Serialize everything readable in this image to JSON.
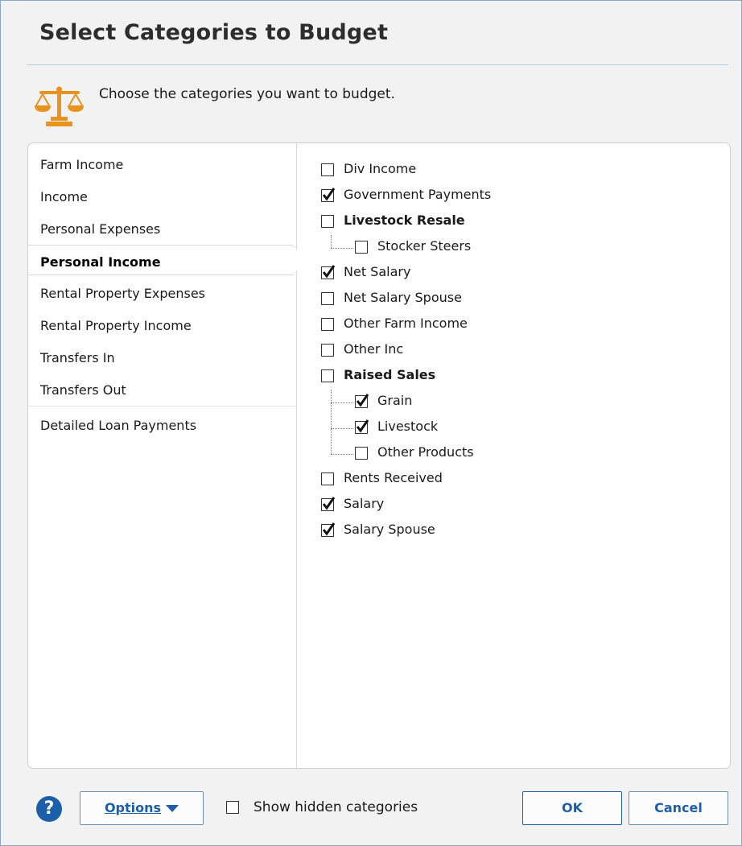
{
  "dialog": {
    "title": "Select Categories to Budget",
    "instruction": "Choose the categories you want to budget."
  },
  "groups": [
    {
      "label": "Farm Income",
      "selected": false
    },
    {
      "label": "Income",
      "selected": false
    },
    {
      "label": "Personal Expenses",
      "selected": false
    },
    {
      "label": "Personal Income",
      "selected": true
    },
    {
      "label": "Rental Property Expenses",
      "selected": false
    },
    {
      "label": "Rental Property Income",
      "selected": false
    },
    {
      "label": "Transfers In",
      "selected": false
    },
    {
      "label": "Transfers Out",
      "selected": false
    },
    {
      "label": "Detailed Loan Payments",
      "selected": false
    }
  ],
  "categories": [
    {
      "label": "Div Income",
      "checked": false,
      "bold": false,
      "level": 0
    },
    {
      "label": "Government Payments",
      "checked": true,
      "bold": false,
      "level": 0
    },
    {
      "label": "Livestock Resale",
      "checked": false,
      "bold": true,
      "level": 0
    },
    {
      "label": "Stocker Steers",
      "checked": false,
      "bold": false,
      "level": 1
    },
    {
      "label": "Net Salary",
      "checked": true,
      "bold": false,
      "level": 0
    },
    {
      "label": "Net Salary Spouse",
      "checked": false,
      "bold": false,
      "level": 0
    },
    {
      "label": "Other Farm Income",
      "checked": false,
      "bold": false,
      "level": 0
    },
    {
      "label": "Other Inc",
      "checked": false,
      "bold": false,
      "level": 0
    },
    {
      "label": "Raised Sales",
      "checked": false,
      "bold": true,
      "level": 0
    },
    {
      "label": "Grain",
      "checked": true,
      "bold": false,
      "level": 1
    },
    {
      "label": "Livestock",
      "checked": true,
      "bold": false,
      "level": 1
    },
    {
      "label": "Other Products",
      "checked": false,
      "bold": false,
      "level": 1
    },
    {
      "label": "Rents Received",
      "checked": false,
      "bold": false,
      "level": 0
    },
    {
      "label": "Salary",
      "checked": true,
      "bold": false,
      "level": 0
    },
    {
      "label": "Salary Spouse",
      "checked": true,
      "bold": false,
      "level": 0
    }
  ],
  "footer": {
    "options_label": "Options",
    "show_hidden_label": "Show hidden categories",
    "show_hidden_checked": false,
    "ok_label": "OK",
    "cancel_label": "Cancel"
  },
  "colors": {
    "accent": "#1b5ea9",
    "icon_gold": "#e8931e"
  },
  "icons": {
    "instruction": "scales-icon",
    "help": "help-icon",
    "options_dropdown": "caret-down-icon"
  }
}
